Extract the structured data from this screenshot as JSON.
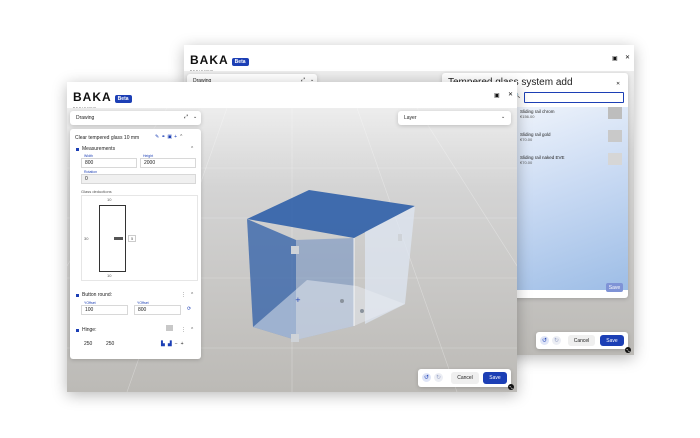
{
  "back_window": {
    "logo": "BAKA",
    "logo_sub": "DESIGNER",
    "badge": "Beta",
    "drawing_label": "Drawing",
    "panel_title": "Tempered glass system add",
    "search_value": "",
    "items": [
      {
        "name": "Sliding rail chrom",
        "price": "€156.00"
      },
      {
        "name": "Sliding rail gold",
        "price": "€70.00"
      },
      {
        "name": "Sliding rail naked EVE",
        "price": "€70.00"
      }
    ],
    "panel_save": "Save",
    "cancel_label": "Cancel",
    "save_label": "Save"
  },
  "front_window": {
    "logo": "BAKA",
    "logo_sub": "DESIGNER",
    "badge": "Beta",
    "drawing_label": "Drawing",
    "layer_label": "Layer",
    "glass_title": "Clear tempered glass 10 mm",
    "measurements": {
      "title": "Measurements",
      "width_label": "Width",
      "width_value": "800",
      "height_label": "Height",
      "height_value": "2000",
      "rotation_label": "Rotation",
      "rotation_value": "0",
      "deductions_label": "Glass deductions",
      "top": "10",
      "bottom": "10",
      "left": "30",
      "right": "5"
    },
    "button_round": {
      "title": "Button round:",
      "ypos_label": "YOffset",
      "ypos_value": "100",
      "xpos_label": "YOffset",
      "xpos_value": "800"
    },
    "hinge": {
      "title": "Hinge:",
      "value1": "250",
      "value2": "250"
    },
    "cancel_label": "Cancel",
    "save_label": "Save"
  },
  "colors": {
    "accent": "#1c3fb5",
    "glass": "#2f5fa8"
  }
}
